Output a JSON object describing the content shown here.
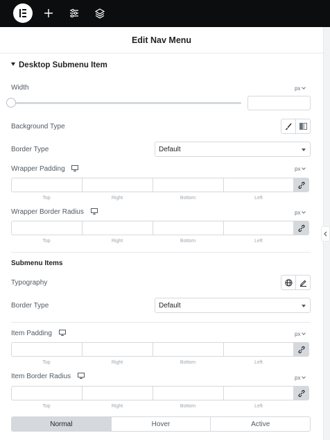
{
  "topbar": {
    "icons": [
      "elementor-logo-icon",
      "plus-icon",
      "sliders-icon",
      "layers-icon"
    ]
  },
  "header": {
    "title": "Edit Nav Menu"
  },
  "section": {
    "title": "Desktop Submenu Item"
  },
  "width": {
    "label": "Width",
    "unit": "px",
    "slider_value": 0,
    "input_value": ""
  },
  "background_type": {
    "label": "Background Type",
    "options": [
      "brush-icon",
      "gradient-icon"
    ]
  },
  "border_type_1": {
    "label": "Border Type",
    "value": "Default"
  },
  "wrapper_padding": {
    "label": "Wrapper Padding",
    "unit": "px"
  },
  "wrapper_border_radius": {
    "label": "Wrapper Border Radius",
    "unit": "px"
  },
  "dimension_labels": {
    "top": "Top",
    "right": "Right",
    "bottom": "Bottom",
    "left": "Left"
  },
  "submenu_items": {
    "heading": "Submenu Items"
  },
  "typography": {
    "label": "Typography"
  },
  "border_type_2": {
    "label": "Border Type",
    "value": "Default"
  },
  "item_padding": {
    "label": "Item Padding",
    "unit": "px"
  },
  "item_border_radius": {
    "label": "Item Border Radius",
    "unit": "px"
  },
  "state_tabs": {
    "normal": "Normal",
    "hover": "Hover",
    "active": "Active",
    "selected": "Normal"
  },
  "colors": {
    "topbar": "#0c0d0e",
    "border": "#d5d8dc",
    "text": "#515962",
    "heading": "#1f2124"
  }
}
